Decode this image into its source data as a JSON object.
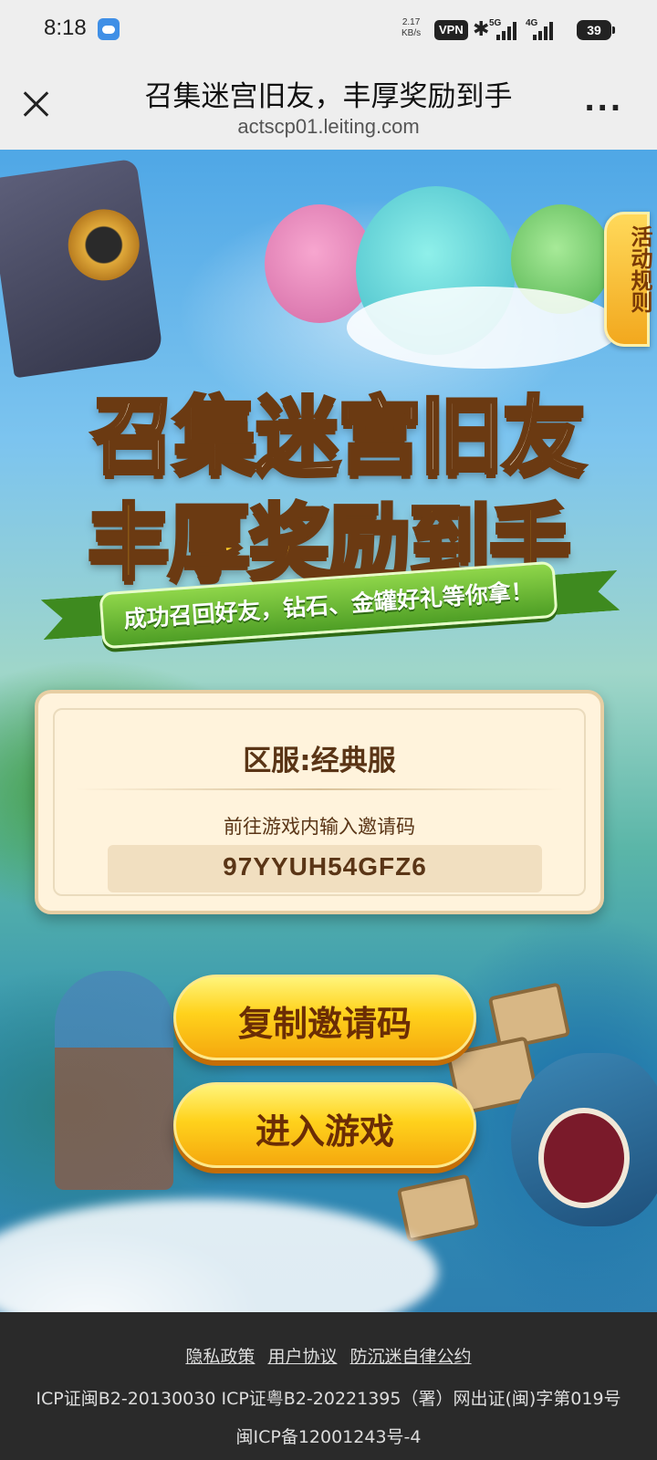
{
  "status_bar": {
    "time": "8:18",
    "net_speed_value": "2.17",
    "net_speed_unit": "KB/s",
    "vpn": "VPN",
    "signal1": "5G",
    "signal2": "4G",
    "battery": "39"
  },
  "title_bar": {
    "title": "召集迷宫旧友，丰厚奖励到手",
    "url": "actscp01.leiting.com",
    "more": "..."
  },
  "hero": {
    "side_tab": "活动规则",
    "logo_line1": "召集迷宫旧友",
    "logo_line2": "丰厚奖励到手",
    "ribbon": "成功召回好友，钻石、金罐好礼等你拿！"
  },
  "invite_card": {
    "server": "区服:经典服",
    "hint": "前往游戏内输入邀请码",
    "code": "97YYUH54GFZ6"
  },
  "buttons": {
    "copy": "复制邀请码",
    "enter": "进入游戏"
  },
  "footer": {
    "links": [
      "隐私政策",
      "用户协议",
      "防沉迷自律公约"
    ],
    "icp1": "ICP证闽B2-20130030  ICP证粤B2-20221395（署）网出证(闽)字第019号",
    "icp2": "闽ICP备12001243号-4"
  },
  "colors": {
    "button_yellow": "#ffd21c",
    "card_bg": "#fff3dc",
    "text_brown": "#5a3516",
    "footer_bg": "#2a2a2a"
  }
}
